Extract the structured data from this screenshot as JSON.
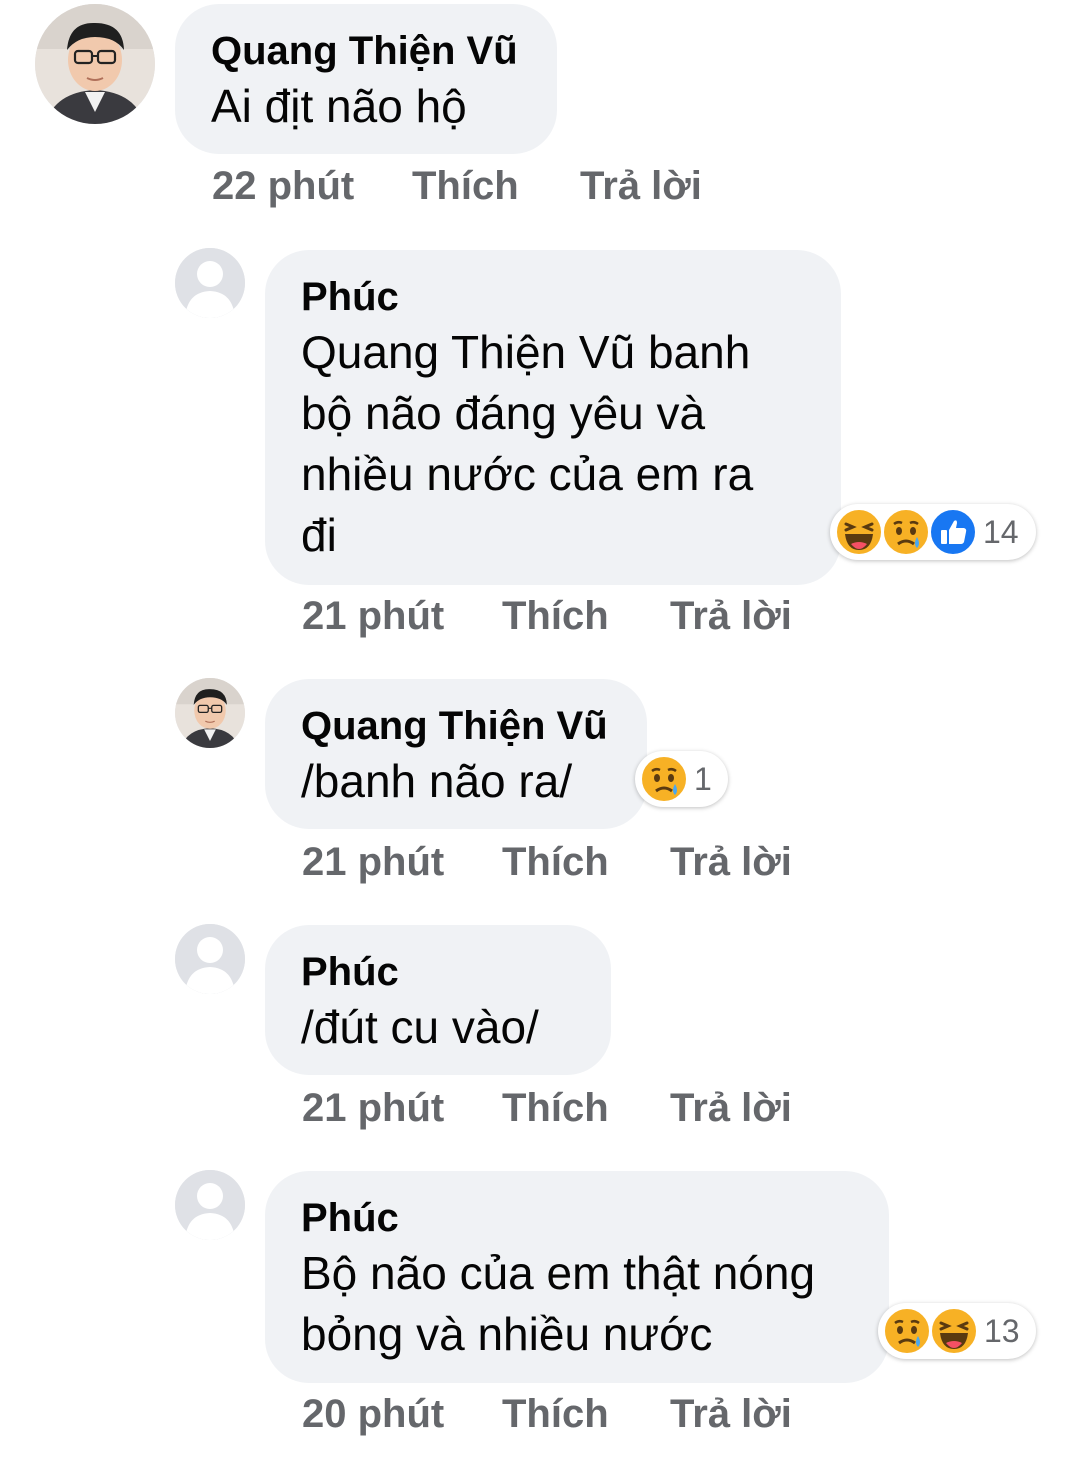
{
  "comments": [
    {
      "author": "Quang Thiện Vũ",
      "text": "Ai địt não hộ",
      "time": "22 phút",
      "like_label": "Thích",
      "reply_label": "Trả lời",
      "avatar": "photo"
    },
    {
      "author": "Phúc",
      "text": "Quang Thiện Vũ banh\nbộ não đáng yêu và\nnhiều nước của em ra\nđi",
      "time": "21 phút",
      "like_label": "Thích",
      "reply_label": "Trả lời",
      "avatar": "default",
      "reactions": {
        "icons": [
          "haha",
          "sad",
          "like"
        ],
        "count": "14"
      }
    },
    {
      "author": "Quang Thiện Vũ",
      "text": "/banh não ra/",
      "time": "21 phút",
      "like_label": "Thích",
      "reply_label": "Trả lời",
      "avatar": "photo",
      "reactions": {
        "icons": [
          "sad"
        ],
        "count": "1"
      }
    },
    {
      "author": "Phúc",
      "text": "/đút cu vào/",
      "time": "21 phút",
      "like_label": "Thích",
      "reply_label": "Trả lời",
      "avatar": "default"
    },
    {
      "author": "Phúc",
      "text": "Bộ não của em thật nóng\nbỏng và nhiều nước",
      "time": "20 phút",
      "like_label": "Thích",
      "reply_label": "Trả lời",
      "avatar": "default",
      "reactions": {
        "icons": [
          "sad",
          "haha"
        ],
        "count": "13"
      }
    }
  ],
  "colors": {
    "bubble": "#f0f2f5",
    "meta_text": "#65676b",
    "like_blue": "#1877f2",
    "emoji_yellow": "#f7b125"
  }
}
